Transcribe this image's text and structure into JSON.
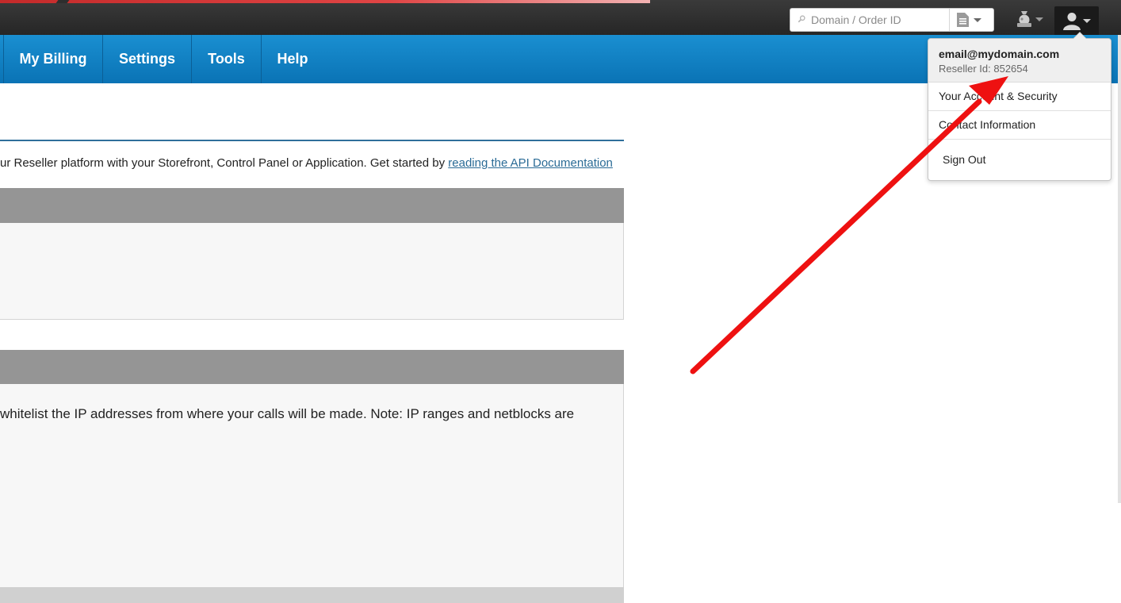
{
  "header": {
    "search": {
      "placeholder": "Domain / Order ID"
    },
    "icons": {
      "search": "search-icon",
      "search_type": "document-icon",
      "tools": "tools-icon",
      "user": "user-icon"
    }
  },
  "nav": {
    "items": [
      {
        "label": "My Billing"
      },
      {
        "label": "Settings"
      },
      {
        "label": "Tools"
      },
      {
        "label": "Help"
      }
    ]
  },
  "main": {
    "intro_text": "ur Reseller platform with your Storefront, Control Panel or Application. Get started by ",
    "intro_link": "reading the API Documentation",
    "whitelist_text": "whitelist the IP addresses from where your calls will be made. Note: IP ranges and netblocks are"
  },
  "user_menu": {
    "email": "email@mydomain.com",
    "reseller_id": "Reseller Id: 852654",
    "items": [
      {
        "label": "Your Account & Security"
      },
      {
        "label": "Contact Information"
      },
      {
        "label": "Sign Out"
      }
    ]
  },
  "colors": {
    "nav_blue": "#0a73b5",
    "topbar_dark": "#2b2b2b",
    "panel_header": "#959595",
    "link": "#2a6b96",
    "annotation_red": "#ee1111"
  }
}
